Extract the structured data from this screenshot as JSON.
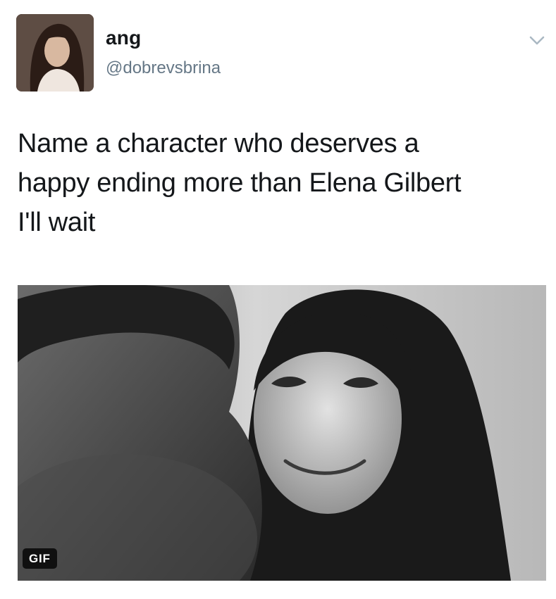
{
  "tweet": {
    "author_name": "ang",
    "author_handle": "@dobrevsbrina",
    "lines": [
      "Name a character who deserves a",
      "happy ending more than Elena Gilbert",
      "I'll wait"
    ],
    "media_badge": "GIF"
  },
  "icons": {
    "menu": "chevron-down-icon",
    "avatar": "avatar"
  },
  "colors": {
    "text_primary": "#14171a",
    "text_secondary": "#657786",
    "chevron": "#aab8c2",
    "badge_bg": "#000000"
  }
}
